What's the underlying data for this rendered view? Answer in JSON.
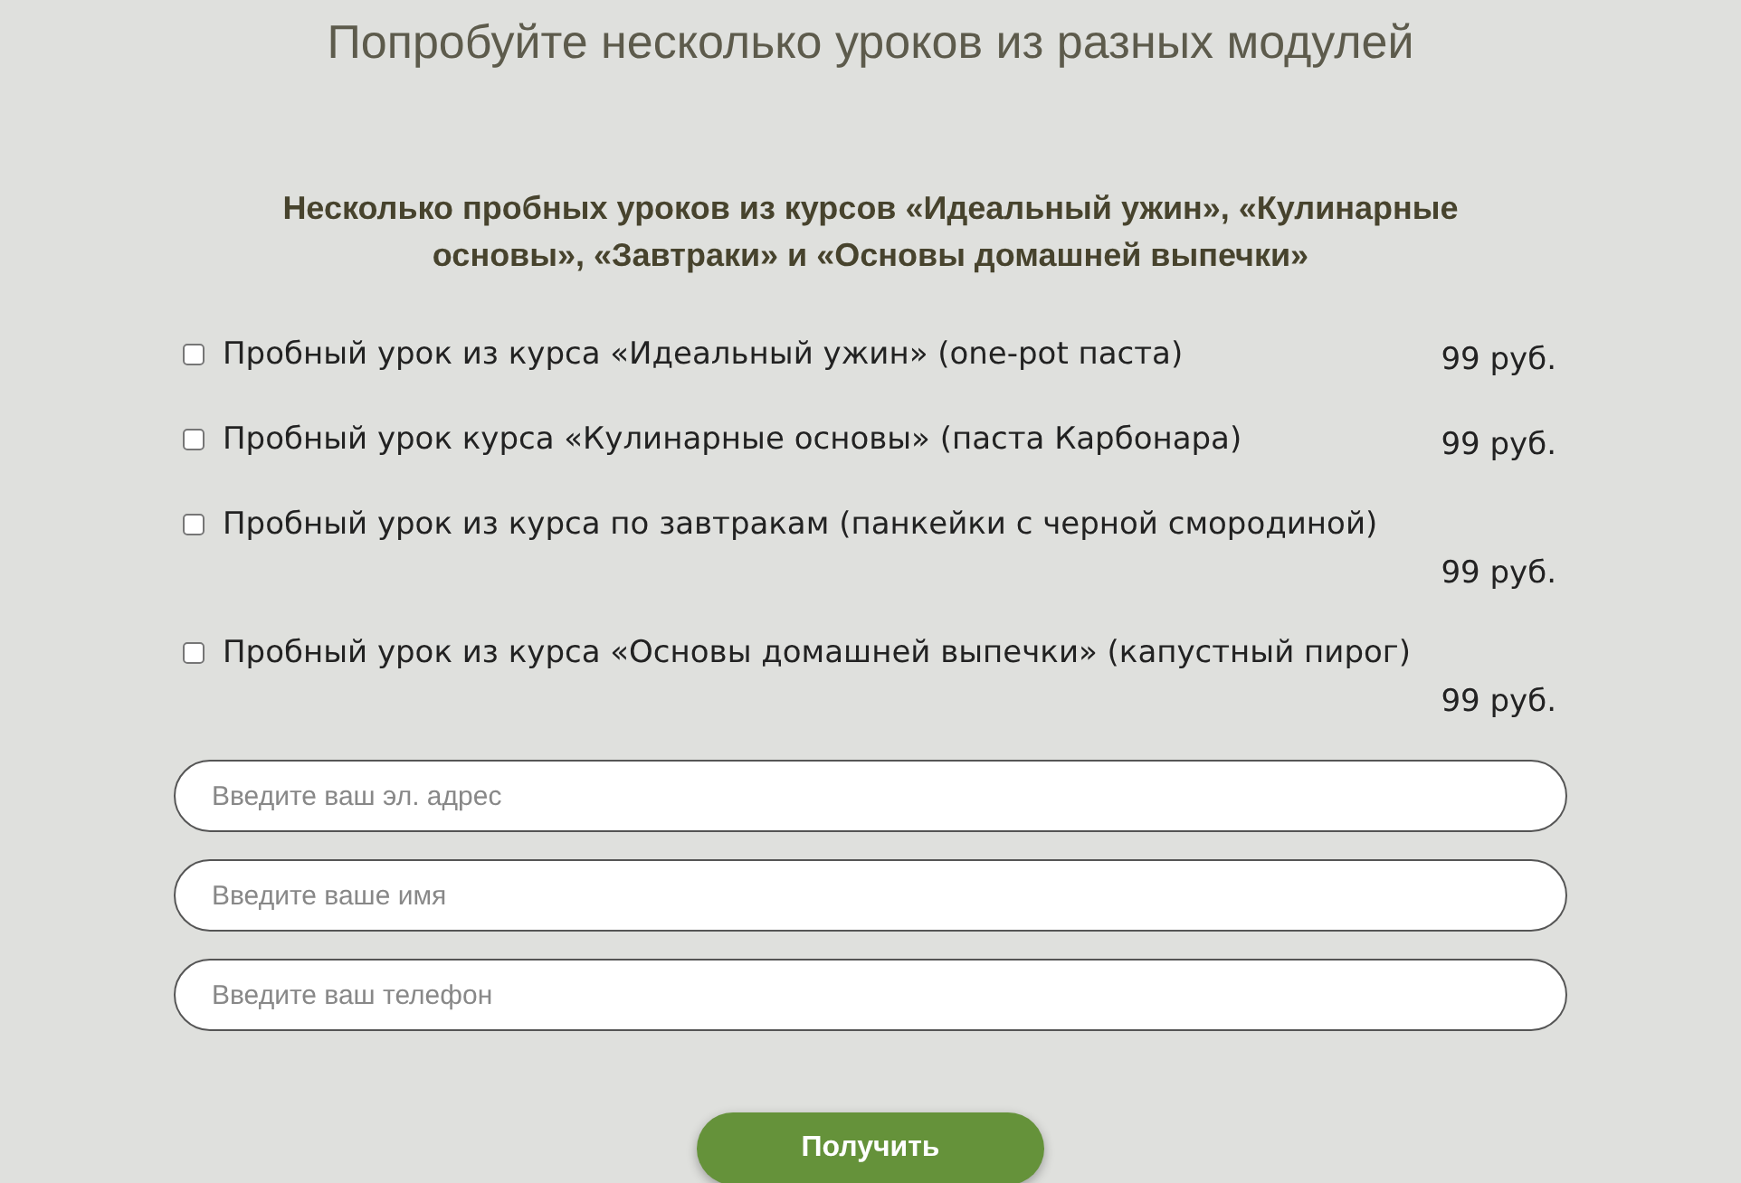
{
  "title": "Попробуйте несколько уроков из разных модулей",
  "subtitle": "Несколько пробных уроков из курсов «Идеальный ужин», «Кулинарные основы», «Завтраки» и «Основы домашней выпечки»",
  "options": [
    {
      "label": "Пробный урок из курса «Идеальный ужин» (one-pot паста)",
      "price": "99 руб.",
      "checked": false
    },
    {
      "label": "Пробный урок курса «Кулинарные основы» (паста Карбонара)",
      "price": "99 руб.",
      "checked": false
    },
    {
      "label": "Пробный урок из курса по завтракам (панкейки с черной смородиной)",
      "price": "99 руб.",
      "checked": false
    },
    {
      "label": "Пробный урок из курса «Основы домашней выпечки» (капустный пирог)",
      "price": "99 руб.",
      "checked": false
    }
  ],
  "fields": [
    {
      "placeholder": "Введите ваш эл. адрес"
    },
    {
      "placeholder": "Введите ваше имя"
    },
    {
      "placeholder": "Введите ваш телефон"
    }
  ],
  "submit": "Получить"
}
